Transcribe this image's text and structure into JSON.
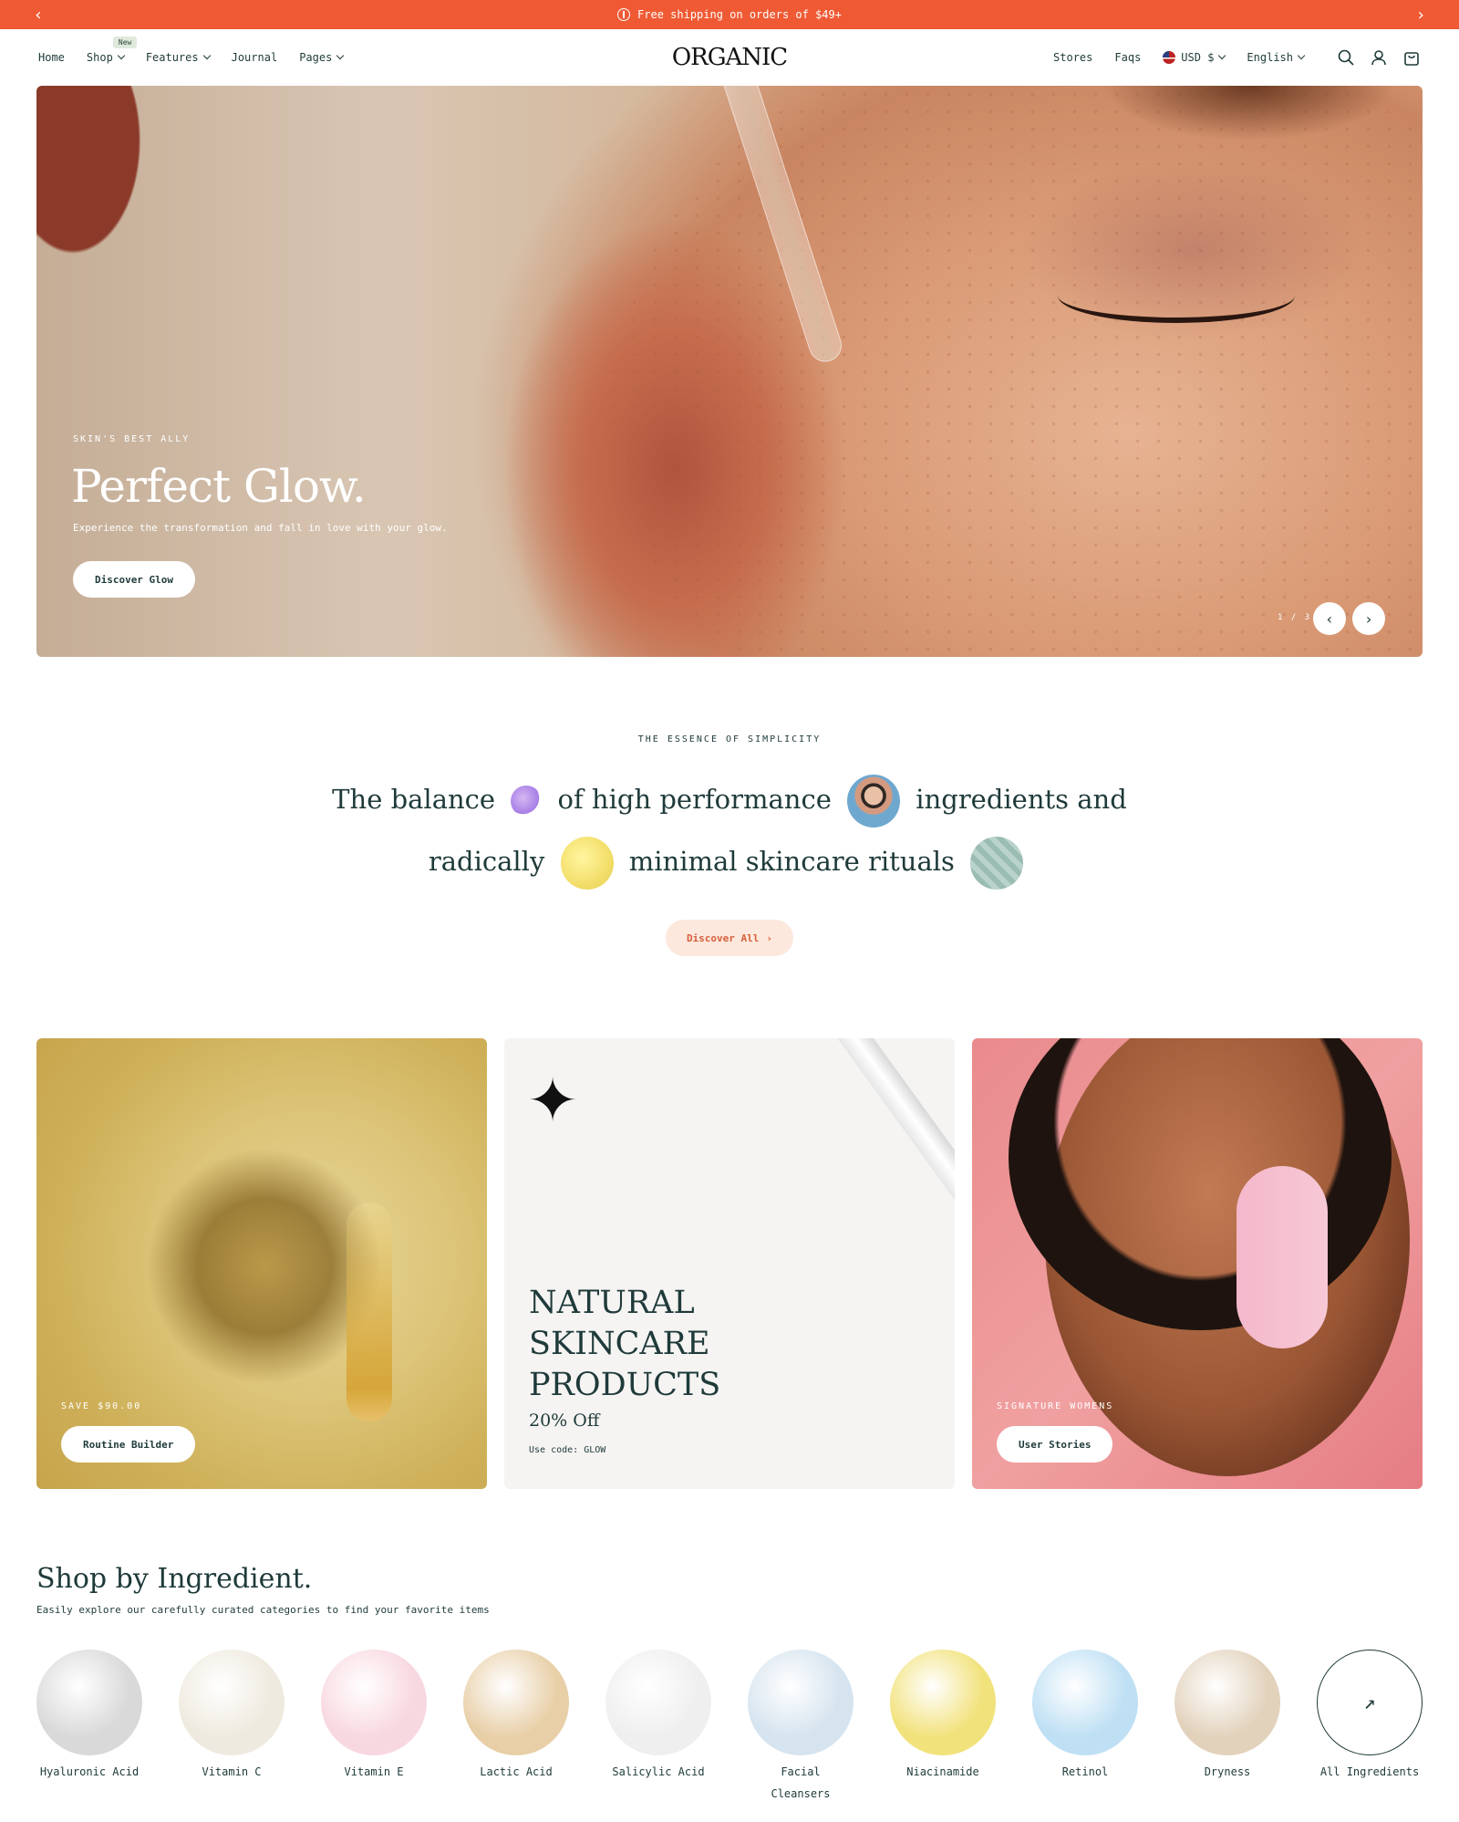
{
  "announcement": {
    "text": "Free shipping on orders of $49+"
  },
  "nav": {
    "home": "Home",
    "shop": "Shop",
    "shop_badge": "New",
    "features": "Features",
    "journal": "Journal",
    "pages": "Pages"
  },
  "logo": "ORGANIC",
  "utility": {
    "stores": "Stores",
    "faqs": "Faqs",
    "currency": "USD $",
    "language": "English"
  },
  "hero": {
    "kicker": "SKIN'S BEST ALLY",
    "title": "Perfect Glow.",
    "subtitle": "Experience the transformation and fall in love with your glow.",
    "button": "Discover Glow",
    "counter": "1 / 3"
  },
  "essence": {
    "kicker": "THE ESSENCE OF SIMPLICITY",
    "part1": "The balance",
    "part2": "of high performance",
    "part3": "ingredients and",
    "part4": "radically",
    "part5": "minimal skincare rituals",
    "button": "Discover All"
  },
  "cards": {
    "card1": {
      "label": "SAVE $90.00",
      "button": "Routine Builder"
    },
    "card2": {
      "title_line1": "NATURAL",
      "title_line2": "SKINCARE",
      "title_line3": "PRODUCTS",
      "offer": "20% Off",
      "code": "Use code: GLOW"
    },
    "card3": {
      "label": "SIGNATURE WOMENS",
      "button": "User Stories"
    }
  },
  "ingredients": {
    "title": "Shop by Ingredient.",
    "subtitle": "Easily explore our carefully curated categories to find your favorite items",
    "items": [
      {
        "name": "Hyaluronic Acid",
        "color": "#d9d9d9"
      },
      {
        "name": "Vitamin C",
        "color": "#efeadf"
      },
      {
        "name": "Vitamin E",
        "color": "#f8d8e0"
      },
      {
        "name": "Lactic Acid",
        "color": "#e8cfa8"
      },
      {
        "name": "Salicylic Acid",
        "color": "#efefef"
      },
      {
        "name": "Facial Cleansers",
        "color": "#d6e4ef"
      },
      {
        "name": "Niacinamide",
        "color": "#f2e27c"
      },
      {
        "name": "Retinol",
        "color": "#bfe0f4"
      },
      {
        "name": "Dryness",
        "color": "#e2d2bc"
      }
    ],
    "all_label": "All Ingredients"
  },
  "colors": {
    "accent": "#ef5a34",
    "text": "#1f3a3a",
    "discover_bg": "#fde8de"
  }
}
